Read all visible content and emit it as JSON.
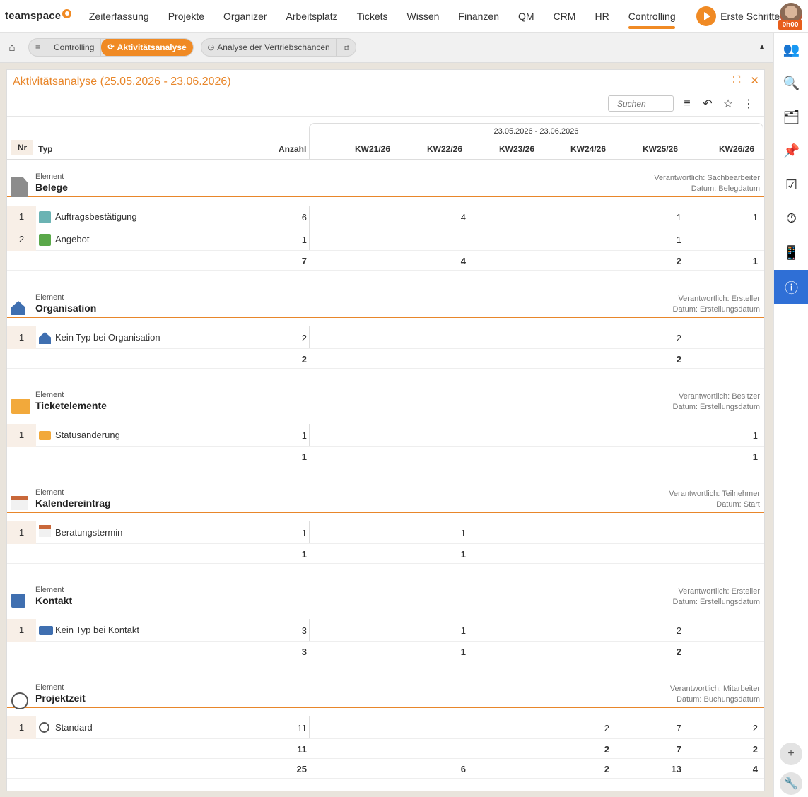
{
  "topnav": {
    "logo": "teamspace",
    "items": [
      "Zeiterfassung",
      "Projekte",
      "Organizer",
      "Arbeitsplatz",
      "Tickets",
      "Wissen",
      "Finanzen",
      "QM",
      "CRM",
      "HR",
      "Controlling"
    ],
    "active": "Controlling",
    "first_steps": "Erste Schritte",
    "timer_badge": "0h00"
  },
  "subbar": {
    "home_icon": "home-icon",
    "crumbs": [
      "Controlling",
      "Aktivitätsanalyse"
    ],
    "other_tab": "Analyse der Vertriebschancen"
  },
  "panel": {
    "title": "Aktivitätsanalyse (25.05.2026 - 23.06.2026)",
    "search_placeholder": "Suchen",
    "period": "23.05.2026 - 23.06.2026",
    "headers": {
      "nr": "Nr",
      "typ": "Typ",
      "anzahl": "Anzahl",
      "weeks": [
        "KW21/26",
        "KW22/26",
        "KW23/26",
        "KW24/26",
        "KW25/26",
        "KW26/26"
      ]
    }
  },
  "sections": [
    {
      "label": "Element",
      "name": "Belege",
      "icon": "document-icon",
      "meta1": "Verantwortlich: Sachbearbeiter",
      "meta2": "Datum: Belegdatum",
      "rows": [
        {
          "nr": "1",
          "typ": "Auftragsbestätigung",
          "icon": "order-confirmation-icon",
          "anzahl": "6",
          "weeks": [
            "",
            "4",
            "",
            "",
            "1",
            "1"
          ]
        },
        {
          "nr": "2",
          "typ": "Angebot",
          "icon": "offer-icon",
          "anzahl": "1",
          "weeks": [
            "",
            "",
            "",
            "",
            "1",
            ""
          ]
        }
      ],
      "sum": {
        "anzahl": "7",
        "weeks": [
          "",
          "4",
          "",
          "",
          "2",
          "1"
        ]
      }
    },
    {
      "label": "Element",
      "name": "Organisation",
      "icon": "organisation-icon",
      "meta1": "Verantwortlich: Ersteller",
      "meta2": "Datum: Erstellungsdatum",
      "rows": [
        {
          "nr": "1",
          "typ": "Kein Typ bei Organisation",
          "icon": "organisation-icon",
          "anzahl": "2",
          "weeks": [
            "",
            "",
            "",
            "",
            "2",
            ""
          ]
        }
      ],
      "sum": {
        "anzahl": "2",
        "weeks": [
          "",
          "",
          "",
          "",
          "2",
          ""
        ]
      }
    },
    {
      "label": "Element",
      "name": "Ticketelemente",
      "icon": "ticket-icon",
      "meta1": "Verantwortlich: Besitzer",
      "meta2": "Datum: Erstellungsdatum",
      "rows": [
        {
          "nr": "1",
          "typ": "Statusänderung",
          "icon": "status-change-icon",
          "anzahl": "1",
          "weeks": [
            "",
            "",
            "",
            "",
            "",
            "1"
          ]
        }
      ],
      "sum": {
        "anzahl": "1",
        "weeks": [
          "",
          "",
          "",
          "",
          "",
          "1"
        ]
      }
    },
    {
      "label": "Element",
      "name": "Kalendereintrag",
      "icon": "calendar-icon",
      "meta1": "Verantwortlich: Teilnehmer",
      "meta2": "Datum: Start",
      "rows": [
        {
          "nr": "1",
          "typ": "Beratungstermin",
          "icon": "calendar-icon",
          "anzahl": "1",
          "weeks": [
            "",
            "1",
            "",
            "",
            "",
            ""
          ]
        }
      ],
      "sum": {
        "anzahl": "1",
        "weeks": [
          "",
          "1",
          "",
          "",
          "",
          ""
        ]
      }
    },
    {
      "label": "Element",
      "name": "Kontakt",
      "icon": "contact-icon",
      "meta1": "Verantwortlich: Ersteller",
      "meta2": "Datum: Erstellungsdatum",
      "rows": [
        {
          "nr": "1",
          "typ": "Kein Typ bei Kontakt",
          "icon": "contact-icon",
          "anzahl": "3",
          "weeks": [
            "",
            "1",
            "",
            "",
            "2",
            ""
          ]
        }
      ],
      "sum": {
        "anzahl": "3",
        "weeks": [
          "",
          "1",
          "",
          "",
          "2",
          ""
        ]
      }
    },
    {
      "label": "Element",
      "name": "Projektzeit",
      "icon": "stopwatch-icon",
      "meta1": "Verantwortlich: Mitarbeiter",
      "meta2": "Datum: Buchungsdatum",
      "rows": [
        {
          "nr": "1",
          "typ": "Standard",
          "icon": "stopwatch-icon",
          "anzahl": "11",
          "weeks": [
            "",
            "",
            "",
            "2",
            "7",
            "2"
          ]
        }
      ],
      "sum": {
        "anzahl": "11",
        "weeks": [
          "",
          "",
          "",
          "2",
          "7",
          "2"
        ]
      }
    }
  ],
  "total": {
    "anzahl": "25",
    "weeks": [
      "",
      "6",
      "",
      "2",
      "13",
      "4"
    ]
  },
  "colors": {
    "accent": "#f08a24",
    "active_sidebar": "#2f6fd6"
  }
}
